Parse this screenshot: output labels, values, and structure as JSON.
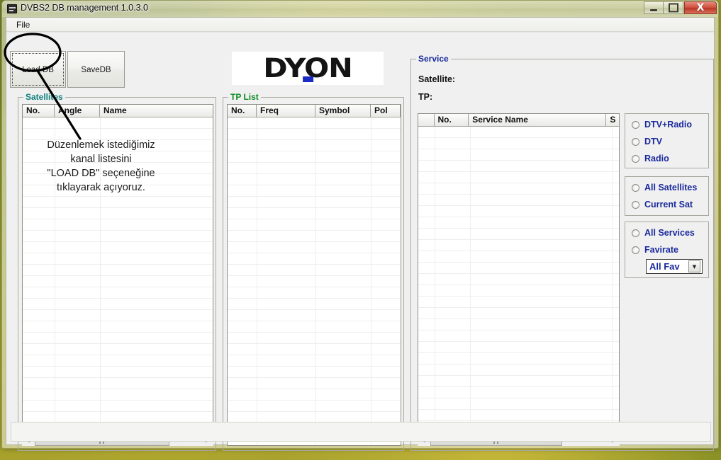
{
  "window": {
    "title": "DVBS2 DB management 1.0.3.0",
    "icon": "app-icon",
    "minimize_label": "",
    "maximize_label": "",
    "close_label": "X"
  },
  "menubar": {
    "items": [
      {
        "label": "File"
      }
    ]
  },
  "toolbar": {
    "load_db_label": "Load DB",
    "save_db_label": "SaveDB"
  },
  "logo": {
    "text": "DYON",
    "accent_color": "#1b2bc4"
  },
  "satellites": {
    "title": "Satellites",
    "title_color": "#108080",
    "columns": [
      "No.",
      "Angle",
      "Name"
    ],
    "rows": [],
    "scrollbar": {
      "left_arrow": "◄",
      "right_arrow": "►",
      "grip": "‖‖"
    }
  },
  "tplist": {
    "title": "TP List",
    "title_color": "#0b8a1f",
    "columns": [
      "No.",
      "Freq",
      "Symbol",
      "Pol"
    ],
    "rows": []
  },
  "service": {
    "title": "Service",
    "title_color": "#1a2a9c",
    "satellite_label": "Satellite:",
    "satellite_value": "",
    "tp_label": "TP:",
    "tp_value": "",
    "columns": [
      "",
      "No.",
      "Service Name",
      "S"
    ],
    "rows": [],
    "scrollbar": {
      "left_arrow": "◄",
      "right_arrow": "►",
      "grip": "‖‖"
    },
    "filter_type": {
      "options": [
        {
          "label": "DTV+Radio",
          "selected": false
        },
        {
          "label": "DTV",
          "selected": false
        },
        {
          "label": "Radio",
          "selected": false
        }
      ]
    },
    "filter_satellite": {
      "options": [
        {
          "label": "All Satellites",
          "selected": false
        },
        {
          "label": "Current Sat",
          "selected": false
        }
      ]
    },
    "filter_favourite": {
      "options": [
        {
          "label": "All Services",
          "selected": false
        },
        {
          "label": "Favirate",
          "selected": false
        }
      ],
      "combo_value": "All Fav",
      "combo_arrow": "▼"
    }
  },
  "annotation": {
    "text": "Düzenlemek istediğimiz\nkanal listesini\n\"LOAD DB\" seçeneğine\ntıklayarak açıyoruz.",
    "color": "#1c1c1c"
  },
  "statusbar": {
    "text": ""
  }
}
